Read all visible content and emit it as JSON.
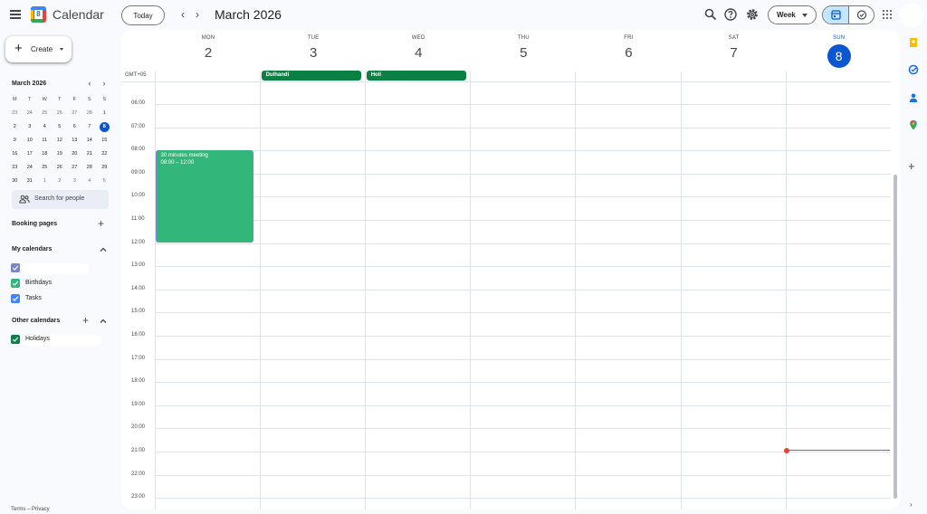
{
  "app": {
    "title": "Calendar",
    "logo_text": "8"
  },
  "toolbar": {
    "today_label": "Today",
    "prev_icon": "chevron-left-icon",
    "next_icon": "chevron-right-icon",
    "period": "March 2026",
    "view_label": "Week"
  },
  "sidebar": {
    "create_label": "Create",
    "mini_calendar": {
      "title": "March 2026",
      "weekdays": [
        "M",
        "T",
        "W",
        "T",
        "F",
        "S",
        "S"
      ],
      "weeks": [
        [
          "23",
          "24",
          "25",
          "26",
          "27",
          "28",
          "1"
        ],
        [
          "2",
          "3",
          "4",
          "5",
          "6",
          "7",
          "8"
        ],
        [
          "9",
          "10",
          "11",
          "12",
          "13",
          "14",
          "15"
        ],
        [
          "16",
          "17",
          "18",
          "19",
          "20",
          "21",
          "22"
        ],
        [
          "23",
          "24",
          "25",
          "26",
          "27",
          "28",
          "29"
        ],
        [
          "30",
          "31",
          "1",
          "2",
          "3",
          "4",
          "5"
        ]
      ],
      "today": "8"
    },
    "search_people_placeholder": "Search for people",
    "booking_pages_label": "Booking pages",
    "my_calendars_label": "My calendars",
    "my_calendars": [
      {
        "label": "",
        "color": "#7986cb"
      },
      {
        "label": "Birthdays",
        "color": "#33b679"
      },
      {
        "label": "Tasks",
        "color": "#4285f4"
      }
    ],
    "other_calendars_label": "Other calendars",
    "other_calendars": [
      {
        "label": "Holidays",
        "color": "#0b8043"
      }
    ],
    "footer": "Terms – Privacy"
  },
  "week": {
    "timezone": "GMT+05",
    "days": [
      {
        "dow": "MON",
        "date": "2"
      },
      {
        "dow": "TUE",
        "date": "3"
      },
      {
        "dow": "WED",
        "date": "4"
      },
      {
        "dow": "THU",
        "date": "5"
      },
      {
        "dow": "FRI",
        "date": "6"
      },
      {
        "dow": "SAT",
        "date": "7"
      },
      {
        "dow": "SUN",
        "date": "8",
        "today": true
      }
    ],
    "hour_labels": [
      "06:00",
      "07:00",
      "08:00",
      "09:00",
      "10:00",
      "11:00",
      "12:00",
      "13:00",
      "14:00",
      "15:00",
      "16:00",
      "17:00",
      "18:00",
      "19:00",
      "20:00",
      "21:00",
      "22:00",
      "23:00"
    ],
    "all_day_events": [
      {
        "title": "Dulhandi",
        "day": "TUE",
        "color": "#0b8043"
      },
      {
        "title": "Holi",
        "day": "WED",
        "color": "#0b8043"
      }
    ],
    "events": [
      {
        "title": "30 minutes meeting",
        "time": "08:00 – 12:00",
        "day": "MON",
        "start": "08:00",
        "end": "12:00",
        "color": "#33b679"
      }
    ],
    "current_time_day": "SUN"
  },
  "colors": {
    "accent": "#0b57d0",
    "now_line": "#ea4335",
    "holiday_chip": "#0b8043",
    "event": "#33b679"
  },
  "right_rail": {
    "icons": [
      "keep-icon",
      "tasks-icon",
      "contacts-icon",
      "maps-icon",
      "plus-icon"
    ]
  }
}
